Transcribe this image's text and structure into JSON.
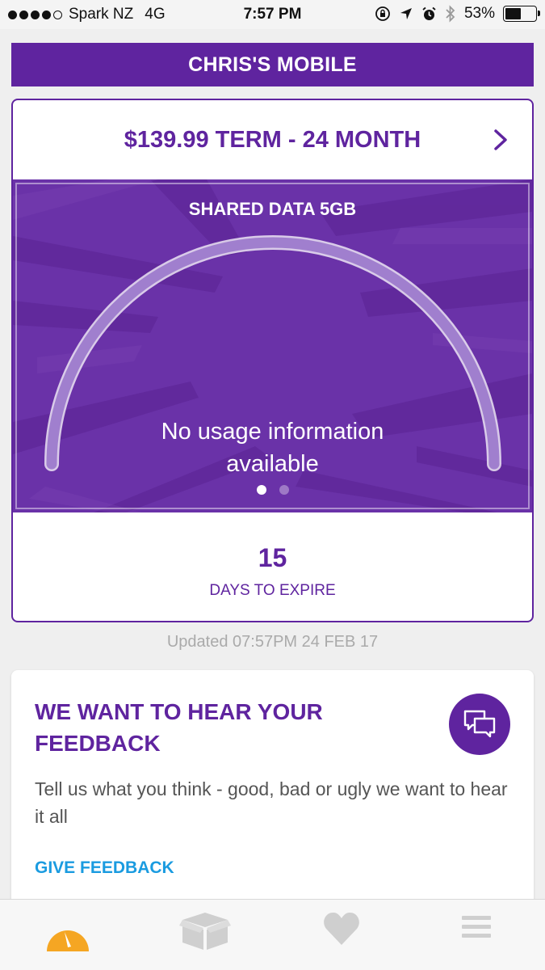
{
  "status_bar": {
    "carrier": "Spark NZ",
    "network": "4G",
    "time": "7:57 PM",
    "battery": "53%",
    "battery_level": 0.53,
    "icons": [
      "orientation-lock-icon",
      "location-icon",
      "alarm-icon",
      "bluetooth-icon"
    ]
  },
  "header": {
    "title": "CHRIS'S MOBILE"
  },
  "plan": {
    "name": "$139.99 TERM - 24 MONTH",
    "usage_title": "SHARED DATA 5GB",
    "usage_message_line1": "No usage information",
    "usage_message_line2": "available",
    "page_count": 2,
    "active_page": 1,
    "days": "15",
    "days_label": "DAYS TO EXPIRE"
  },
  "updated": "Updated 07:57PM 24 FEB 17",
  "feedback": {
    "title": "WE WANT TO HEAR YOUR FEEDBACK",
    "description": "Tell us what you think - good, bad or ugly we want to hear it all",
    "link": "GIVE FEEDBACK",
    "icon": "chat-bubbles-icon"
  },
  "tabs": [
    {
      "icon": "usage-gauge-icon",
      "active": true
    },
    {
      "icon": "box-icon",
      "active": false
    },
    {
      "icon": "heart-icon",
      "active": false
    },
    {
      "icon": "menu-icon",
      "active": false
    }
  ],
  "colors": {
    "brand_purple": "#5f249f",
    "panel_purple": "#6a32a8",
    "link_blue": "#1a9be0",
    "tab_active": "#f5a623",
    "tab_inactive": "#cfcfcf"
  }
}
